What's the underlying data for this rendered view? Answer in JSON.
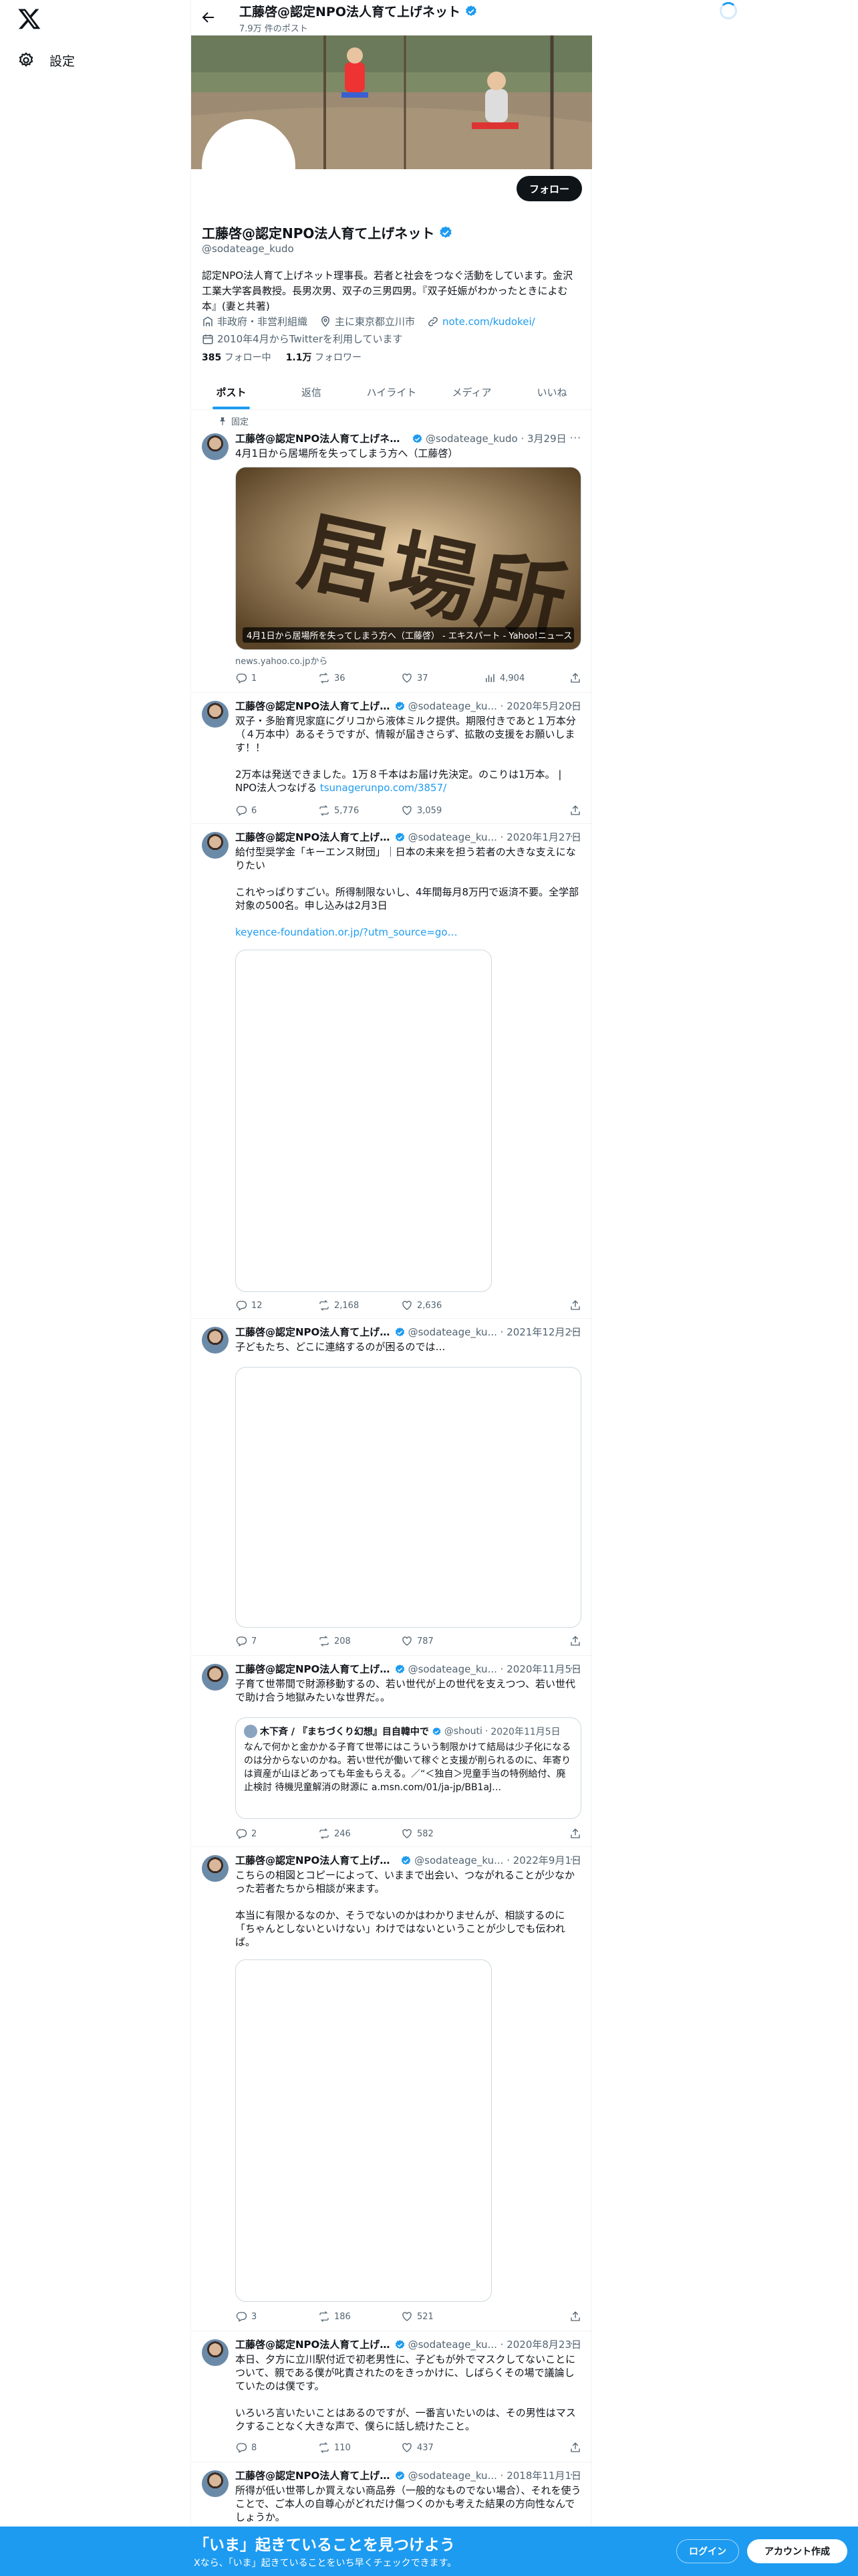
{
  "nav": {
    "settings_label": "設定"
  },
  "header": {
    "name": "工藤啓@認定NPO法人育て上げネット",
    "post_count": "7.9万 件のポスト"
  },
  "profile": {
    "follow_label": "フォロー",
    "name": "工藤啓@認定NPO法人育て上げネット",
    "handle": "@sodateage_kudo",
    "bio": "認定NPO法人育て上げネット理事長。若者と社会をつなぐ活動をしています。金沢工業大学客員教授。長男次男、双子の三男四男。『双子妊娠がわかったときによむ本』(妻と共著)",
    "category": "非政府・非営利組織",
    "location": "主に東京都立川市",
    "website": "note.com/kudokei/",
    "joined": "2010年4月からTwitterを利用しています",
    "following_count": "385",
    "following_label": "フォロー中",
    "followers_count": "1.1万",
    "followers_label": "フォロワー"
  },
  "tabs": [
    "ポスト",
    "返信",
    "ハイライト",
    "メディア",
    "いいね"
  ],
  "pinned_label": "固定",
  "posts": [
    {
      "name": "工藤啓@認定NPO法人育て上げネット",
      "handle": "@sodateage_kudo",
      "date": "3月29日",
      "text": "4月1日から居場所を失ってしまう方へ（工藤啓）",
      "card_caption": "4月1日から居場所を失ってしまう方へ（工藤啓） - エキスパート - Yahoo!ニュース",
      "card_image_text": "居場所",
      "card_source": "news.yahoo.co.jpから",
      "replies": "1",
      "reposts": "36",
      "likes": "37",
      "views": "4,904"
    },
    {
      "name": "工藤啓@認定NPO法人育て上げネット",
      "handle": "@sodateage_ku...",
      "date": "2020年5月20日",
      "text": "双子・多胎育児家庭にグリコから液体ミルク提供。期限付きであと１万本分（４万本中）あるそうですが、情報が届きさらず、拡散の支援をお願いします！！\n\n2万本は発送できました。1万８千本はお届け先決定。のこりは1万本。 | NPO法人つなげる ",
      "link": "tsunagerunpo.com/3857/",
      "replies": "6",
      "reposts": "5,776",
      "likes": "3,059"
    },
    {
      "name": "工藤啓@認定NPO法人育て上げネット",
      "handle": "@sodateage_ku...",
      "date": "2020年1月27日",
      "text": "給付型奨学金「キーエンス財団」｜日本の未来を担う若者の大きな支えになりたい\n\nこれやっぱりすごい。所得制限ないし、4年間毎月8万円で返済不要。全学部対象の500名。申し込みは2月3日\n\n",
      "link": "keyence-foundation.or.jp/?utm_source=go…",
      "replies": "12",
      "reposts": "2,168",
      "likes": "2,636"
    },
    {
      "name": "工藤啓@認定NPO法人育て上げネット",
      "handle": "@sodateage_ku...",
      "date": "2021年12月2日",
      "text": "子どもたち、どこに連絡するのが困るのでは…",
      "replies": "7",
      "reposts": "208",
      "likes": "787"
    },
    {
      "name": "工藤啓@認定NPO法人育て上げネット",
      "handle": "@sodateage_ku...",
      "date": "2020年11月5日",
      "text": "子育て世帯間で財源移動するの、若い世代が上の世代を支えつつ、若い世代で助け合う地獄みたいな世界だ。。",
      "quote": {
        "name": "木下斉 / 『まちづくり幻想』目自韓中で",
        "handle": "@shouti",
        "date": "2020年11月5日",
        "text": "なんで何かと金かかる子育て世帯にはこういう制限かけて結局は少子化になるのは分からないのかね。若い世代が働いて稼ぐと支援が削られるのに、年寄りは資産が山ほどあっても年金もらえる。／“＜独自＞児童手当の特例給付、廃止検討 待機児童解消の財源に a.msn.com/01/ja-jp/BB1aJ…"
      },
      "replies": "2",
      "reposts": "246",
      "likes": "582"
    },
    {
      "name": "工藤啓@認定NPO法人育て上げネット",
      "handle": "@sodateage_ku...",
      "date": "2022年9月1日",
      "text": "こちらの相図とコピーによって、いままで出会い、つながれることが少なかった若者たちから相談が来ます。\n\n本当に有限かるなのか、そうでないのかはわかりませんが、相談するのに「ちゃんとしないといけない」わけではないということが少しでも伝われば。",
      "replies": "3",
      "reposts": "186",
      "likes": "521"
    },
    {
      "name": "工藤啓@認定NPO法人育て上げネット",
      "handle": "@sodateage_ku...",
      "date": "2020年8月23日",
      "text": "本日、夕方に立川駅付近で初老男性に、子どもが外でマスクしてないことについて、親である僕が叱責されたのをきっかけに、しばらくその場で議論していたのは僕です。\n\nいろいろ言いたいことはあるのですが、一番言いたいのは、その男性はマスクすることなく大きな声で、僕らに話し続けたこと。",
      "replies": "8",
      "reposts": "110",
      "likes": "437"
    },
    {
      "name": "工藤啓@認定NPO法人育て上げネット",
      "handle": "@sodateage_ku...",
      "date": "2018年11月1日",
      "text": "所得が低い世帯しか買えない商品券（一般的なものでない場合）、それを使うことで、ご本人の自尊心がどれだけ傷つくのかも考えた結果の方向性なんでしょうか。",
      "replies": "",
      "reposts": "",
      "likes": ""
    }
  ],
  "bottom_bar": {
    "title": "「いま」起きていることを見つけよう",
    "subtitle": "Xなら、「いま」起きていることをいち早くチェックできます。",
    "login_label": "ログイン",
    "signup_label": "アカウント作成"
  },
  "colors": {
    "accent": "#1d9bf0",
    "text": "#0f1419",
    "muted": "#536471",
    "border": "#eff3f4"
  }
}
